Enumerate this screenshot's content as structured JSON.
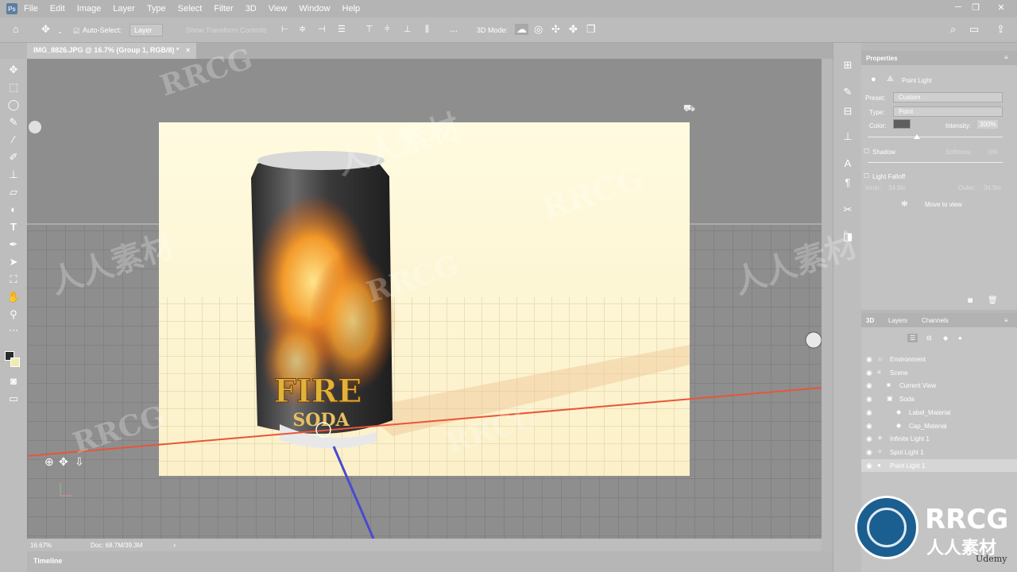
{
  "menubar": {
    "app_icon": "Ps",
    "items": [
      "File",
      "Edit",
      "Image",
      "Layer",
      "Type",
      "Select",
      "Filter",
      "3D",
      "View",
      "Window",
      "Help"
    ]
  },
  "options": {
    "auto_select_label": "Auto-Select:",
    "auto_select_value": "Layer",
    "show_transform_controls": "Show Transform Controls",
    "mode_label": "3D Mode:",
    "more_label": "..."
  },
  "document": {
    "tab_title": "IMG_8826.JPG @ 16.7% (Group 1, RGB/8) *",
    "close_glyph": "×"
  },
  "status": {
    "zoom": "16.67%",
    "doc_size": "Doc: 68.7M/39.3M",
    "arrow": "›"
  },
  "timeline": {
    "label": "Timeline"
  },
  "can_text": {
    "line1": "FIRE",
    "line2": "SODA"
  },
  "properties": {
    "title": "Properties",
    "light_type_name": "Point Light",
    "preset_label": "Preset:",
    "preset_value": "Custom",
    "type_label": "Type:",
    "type_value": "Point",
    "color_label": "Color:",
    "light_color": "#5e5e5e",
    "intensity_label": "Intensity:",
    "intensity_value": "300%",
    "shadow_label": "Shadow",
    "softness_label": "Softness:",
    "softness_value": "0%",
    "light_falloff_label": "Light Falloff",
    "inner_label": "Inner:",
    "inner_value": "34.9in",
    "outer_label": "Outer:",
    "outer_value": "34.9in",
    "move_to_view": "Move to view"
  },
  "panel3d": {
    "tabs": [
      "3D",
      "Layers",
      "Channels"
    ],
    "layers": [
      {
        "name": "Environment",
        "icon": "☼"
      },
      {
        "name": "Scene",
        "icon": "≡"
      },
      {
        "name": "Current View",
        "icon": "■"
      },
      {
        "name": "Soda",
        "icon": "▣"
      },
      {
        "name": "Label_Material",
        "icon": "◆"
      },
      {
        "name": "Cap_Material",
        "icon": "◆"
      },
      {
        "name": "Infinite Light 1",
        "icon": "✳"
      },
      {
        "name": "Spot Light 1",
        "icon": "✧"
      },
      {
        "name": "Point Light 1",
        "icon": "●"
      }
    ]
  },
  "watermark": {
    "brand": "RRCG",
    "cn": "人人素材",
    "udemy": "Udemy"
  },
  "colors": {
    "accent_red_axis": "#e8553a",
    "accent_blue_axis": "#4a4ad0",
    "floor": "#f7ecc4"
  }
}
